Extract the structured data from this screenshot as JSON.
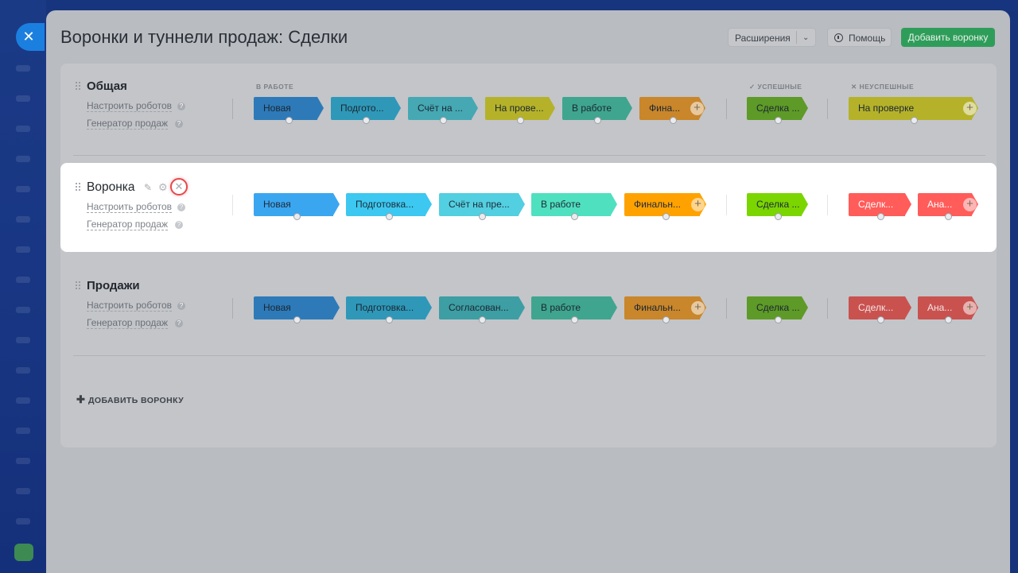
{
  "window": {
    "close_glyph": "✕"
  },
  "header": {
    "title": "Воронки и туннели продаж: Сделки",
    "extensions_label": "Расширения",
    "help_label": "Помощь",
    "add_funnel_label": "Добавить воронку"
  },
  "columns": {
    "in_work": "В РАБОТЕ",
    "success": "УСПЕШНЫЕ",
    "failed": "НЕУСПЕШНЫЕ"
  },
  "links": {
    "robots": "Настроить роботов",
    "generator": "Генератор продаж"
  },
  "funnels": [
    {
      "name": "Общая",
      "stages": [
        "Новая",
        "Подгото...",
        "Счёт на ...",
        "На провe...",
        "В работе",
        "Фина..."
      ],
      "success": [
        "Сделка ..."
      ],
      "failed": [
        "На проверке"
      ]
    },
    {
      "name": "Воронка",
      "stages": [
        "Новая",
        "Подготовка...",
        "Счёт на пре...",
        "В работе",
        "Финальн..."
      ],
      "success": [
        "Сделка ..."
      ],
      "failed": [
        "Сделк...",
        "Ана..."
      ]
    },
    {
      "name": "Продажи",
      "stages": [
        "Новая",
        "Подготовка...",
        "Согласован...",
        "В работе",
        "Финальн..."
      ],
      "success": [
        "Сделка ..."
      ],
      "failed": [
        "Сделк...",
        "Ана..."
      ]
    }
  ],
  "add_funnel_link": "ДОБАВИТЬ ВОРОНКУ",
  "colors": {
    "accent_green": "#2f9d5a",
    "delete_highlight": "#e8484d",
    "stage_blue": "#3ba6f0",
    "stage_cyan": "#3cc8f0",
    "stage_teal": "#52cfe0",
    "stage_mint": "#4fe0c0",
    "stage_orange": "#ffa200",
    "stage_yellow": "#e0e000",
    "success_green": "#7bd500",
    "fail_red": "#ff5c5a"
  }
}
